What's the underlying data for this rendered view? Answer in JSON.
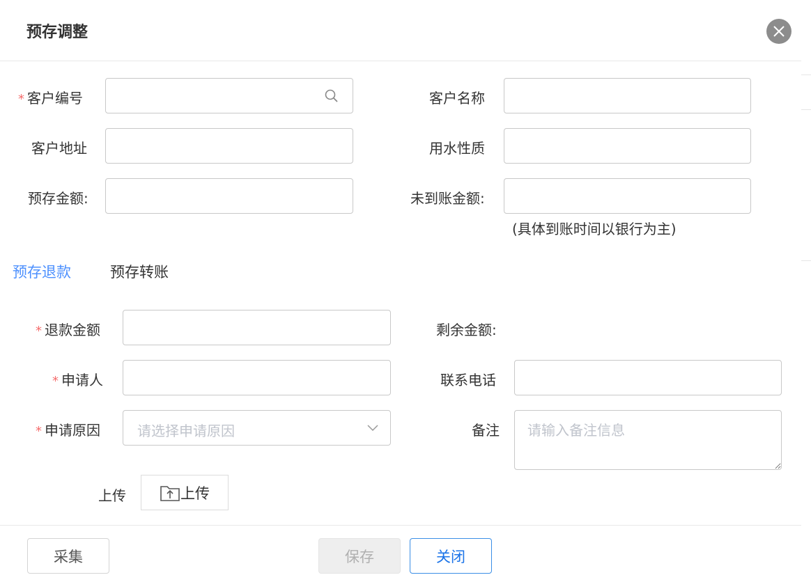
{
  "dialog": {
    "title": "预存调整",
    "close_icon": "close-icon"
  },
  "form": {
    "customer_no": {
      "label": "客户编号",
      "value": "",
      "icon": "search-icon",
      "required": true
    },
    "customer_name": {
      "label": "客户名称",
      "value": ""
    },
    "customer_address": {
      "label": "客户地址",
      "value": ""
    },
    "water_nature": {
      "label": "用水性质",
      "value": ""
    },
    "prestore_amount": {
      "label": "预存金额:",
      "value": ""
    },
    "pending_amount": {
      "label": "未到账金额:",
      "value": ""
    },
    "pending_note": "(具体到账时间以银行为主)"
  },
  "tabs": [
    {
      "label": "预存退款",
      "active": true
    },
    {
      "label": "预存转账",
      "active": false
    }
  ],
  "refund": {
    "refund_amount": {
      "label": "退款金额",
      "value": "",
      "required": true
    },
    "remaining_amount": {
      "label": "剩余金额:",
      "value": ""
    },
    "applicant": {
      "label": "申请人",
      "value": "",
      "required": true
    },
    "phone": {
      "label": "联系电话",
      "value": ""
    },
    "reason": {
      "label": "申请原因",
      "placeholder": "请选择申请原因",
      "required": true,
      "icon": "chevron-down-icon"
    },
    "remark": {
      "label": "备注",
      "placeholder": "请输入备注信息"
    },
    "upload": {
      "label": "上传",
      "button_label": "上传",
      "icon": "upload-folder-icon"
    }
  },
  "footer": {
    "collect_label": "采集",
    "save_label": "保存",
    "close_label": "关闭"
  },
  "colors": {
    "accent": "#4d90fe",
    "required": "#f56c6c",
    "close_button_bg": "#8c8c8c",
    "primary_border": "#3a8ee6"
  }
}
